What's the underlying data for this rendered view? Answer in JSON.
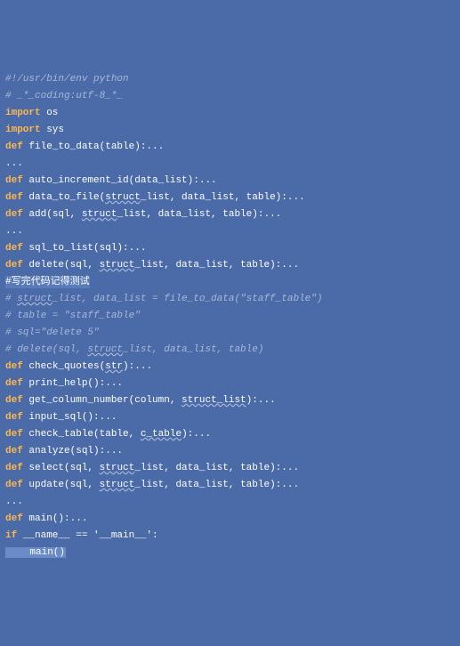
{
  "lines": [
    {
      "type": "comment",
      "text": "#!/usr/bin/env python"
    },
    {
      "type": "comment",
      "text": "# _*_coding:utf-8_*_"
    },
    {
      "type": "import",
      "kw": "import",
      "rest": " os"
    },
    {
      "type": "import",
      "kw": "import",
      "rest": " sys"
    },
    {
      "type": "def",
      "kw": "def",
      "rest": " file_to_data(table):..."
    },
    {
      "type": "ellipsis",
      "text": "..."
    },
    {
      "type": "def",
      "kw": "def",
      "rest": " auto_increment_id(data_list):..."
    },
    {
      "type": "def_ul",
      "kw": "def",
      "pre": " data_to_file(",
      "ul": "struct",
      "post": "_list, data_list, table):..."
    },
    {
      "type": "def_ul",
      "kw": "def",
      "pre": " add(sql, ",
      "ul": "struct",
      "post": "_list, data_list, table):..."
    },
    {
      "type": "ellipsis",
      "text": "..."
    },
    {
      "type": "def",
      "kw": "def",
      "rest": " sql_to_list(sql):..."
    },
    {
      "type": "def_ul",
      "kw": "def",
      "pre": " delete(sql, ",
      "ul": "struct",
      "post": "_list, data_list, table):..."
    },
    {
      "type": "highlight",
      "text": "#写完代码记得测试"
    },
    {
      "type": "comment_ul",
      "pre": "# ",
      "ul": "struct",
      "post": "_list, data_list = file_to_data(\"staff_table\")"
    },
    {
      "type": "comment",
      "text": "# table = \"staff_table\""
    },
    {
      "type": "comment",
      "text": "# sql=\"delete 5\""
    },
    {
      "type": "comment_ul",
      "pre": "# delete(sql, ",
      "ul": "struct",
      "post": "_list, data_list, table)"
    },
    {
      "type": "def_ul",
      "kw": "def",
      "pre": " check_quotes(",
      "ul": "str",
      "post": "):..."
    },
    {
      "type": "def",
      "kw": "def",
      "rest": " print_help():..."
    },
    {
      "type": "def_ul",
      "kw": "def",
      "pre": " get_column_number(column, ",
      "ul": "struct_list",
      "post": "):..."
    },
    {
      "type": "def",
      "kw": "def",
      "rest": " input_sql():..."
    },
    {
      "type": "def_ul",
      "kw": "def",
      "pre": " check_table(table, ",
      "ul": "c_table",
      "post": "):..."
    },
    {
      "type": "def",
      "kw": "def",
      "rest": " analyze(sql):..."
    },
    {
      "type": "def_ul",
      "kw": "def",
      "pre": " select(sql, ",
      "ul": "struct",
      "post": "_list, data_list, table):..."
    },
    {
      "type": "def_ul",
      "kw": "def",
      "pre": " update(sql, ",
      "ul": "struct",
      "post": "_list, data_list, table):..."
    },
    {
      "type": "ellipsis",
      "text": "..."
    },
    {
      "type": "def",
      "kw": "def",
      "rest": " main():..."
    },
    {
      "type": "if",
      "kw": "if",
      "rest": " __name__ == '__main__':"
    },
    {
      "type": "cursor",
      "text": "    main()"
    }
  ]
}
